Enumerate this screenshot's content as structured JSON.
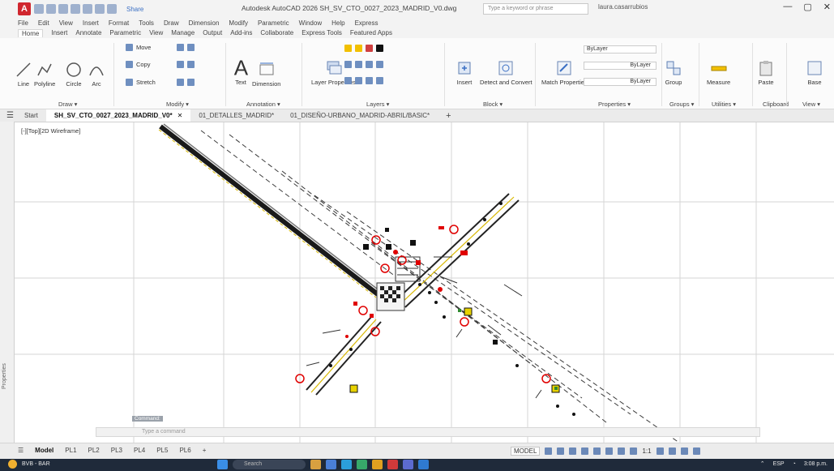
{
  "titlebar": {
    "app_letter": "A",
    "share_label": "Share",
    "title": "Autodesk AutoCAD 2026   SH_SV_CTO_0027_2023_MADRID_V0.dwg",
    "search_placeholder": "Type a keyword or phrase",
    "user": "laura.casarrubios",
    "minimize": "—",
    "maximize": "▢",
    "close": "✕"
  },
  "menubar": {
    "items": [
      "File",
      "Edit",
      "View",
      "Insert",
      "Format",
      "Tools",
      "Draw",
      "Dimension",
      "Modify",
      "Parametric",
      "Window",
      "Help",
      "Express"
    ]
  },
  "ribbon_tabs": {
    "items": [
      "Home",
      "Insert",
      "Annotate",
      "Parametric",
      "View",
      "Manage",
      "Output",
      "Add-ins",
      "Collaborate",
      "Express Tools",
      "Featured Apps"
    ]
  },
  "ribbon": {
    "draw": {
      "line": "Line",
      "polyline": "Polyline",
      "circle": "Circle",
      "arc": "Arc",
      "label": "Draw ▾"
    },
    "modify": {
      "move": "Move",
      "copy": "Copy",
      "stretch": "Stretch",
      "label": "Modify ▾"
    },
    "annotation": {
      "text": "Text",
      "dimension": "Dimension",
      "label": "Annotation ▾"
    },
    "layers": {
      "properties": "Layer Properties",
      "label": "Layers ▾"
    },
    "block": {
      "insert": "Insert",
      "group": "Group",
      "label": "Block ▾"
    },
    "properties_panel": {
      "match": "Match Properties",
      "bylayer_1": "ByLayer",
      "bylayer_2": "ByLayer",
      "bylayer_3": "ByLayer",
      "label": "Properties ▾"
    },
    "groups": {
      "label": "Groups ▾"
    },
    "utilities": {
      "measure": "Measure",
      "label": "Utilities ▾"
    },
    "clipboard": {
      "paste": "Paste",
      "label": "Clipboard"
    },
    "view": {
      "base": "Base",
      "label": "View ▾"
    },
    "detect": {
      "label": "Detect and Convert"
    }
  },
  "filetabs": {
    "start": "Start",
    "tabs": [
      {
        "label": "SH_SV_CTO_0027_2023_MADRID_V0*",
        "close": "✕"
      },
      {
        "label": "01_DETALLES_MADRID*"
      },
      {
        "label": "01_DISEÑO-URBANO_MADRID-ABRIL/BASIC*"
      }
    ],
    "add": "+"
  },
  "viewport": {
    "label": "[-][Top][2D Wireframe]"
  },
  "palette": {
    "label": "Properties"
  },
  "commandline": {
    "placeholder": "Type a command",
    "tag": "Command:"
  },
  "layout_tabs": {
    "items": [
      "Model",
      "PL1",
      "PL2",
      "PL3",
      "PL4",
      "PL5",
      "PL6"
    ],
    "add": "+"
  },
  "status": {
    "model": "MODEL",
    "scale": "1:1"
  },
  "taskbar": {
    "weather": "BVB - BAR",
    "search": "Search",
    "lang": "ESP",
    "time": "3:08 p.m."
  },
  "colors": {
    "accent_red": "#d0262e",
    "road": "#000000",
    "dashed": "#3a3a3a",
    "symbol_red": "#e00000",
    "symbol_yellow": "#e8d200",
    "symbol_green": "#2f8a2f"
  }
}
